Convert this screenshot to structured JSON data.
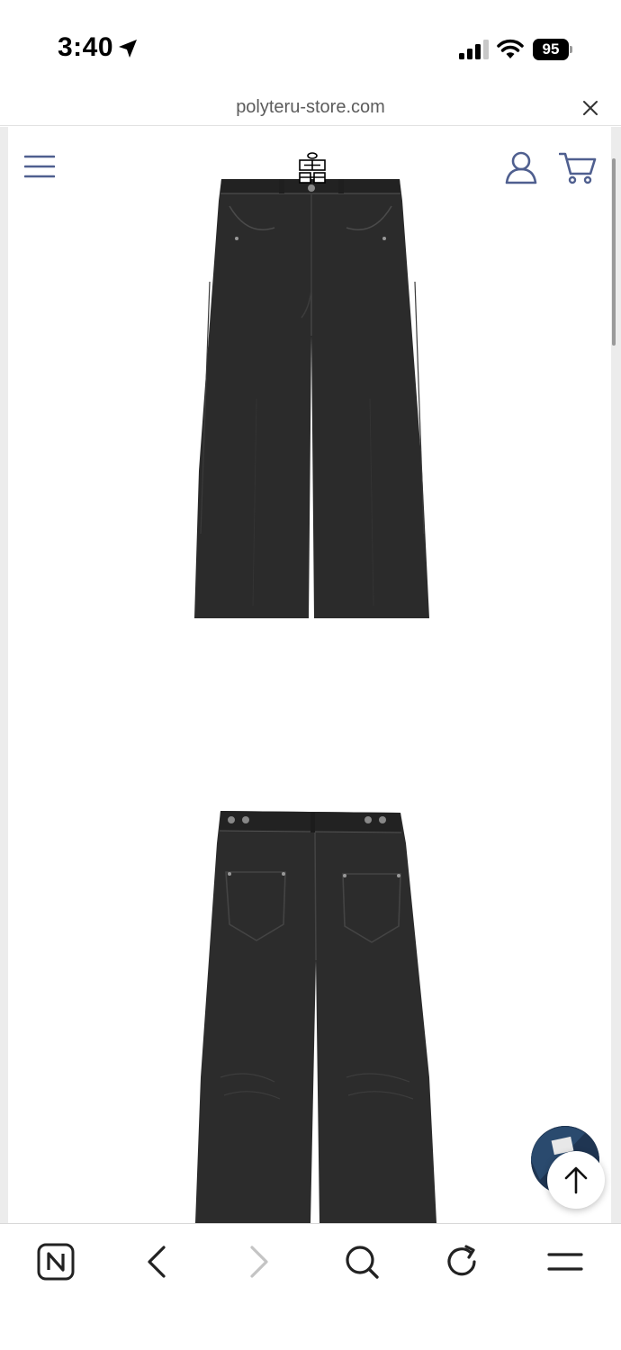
{
  "status_bar": {
    "time": "3:40",
    "battery": "95",
    "icons": [
      "location-arrow-icon",
      "signal-icon",
      "wifi-icon",
      "battery-icon"
    ]
  },
  "browser": {
    "url": "polyteru-store.com",
    "toolbar_icons": [
      "naver-icon",
      "back-icon",
      "forward-icon",
      "search-icon",
      "reload-icon",
      "menu-icon"
    ]
  },
  "site_header": {
    "icons": [
      "hamburger-menu-icon",
      "store-logo",
      "account-icon",
      "cart-icon"
    ]
  },
  "product_images": [
    "jeans-front",
    "jeans-back"
  ],
  "floating": [
    "chat-bubble",
    "scroll-to-top-icon"
  ],
  "colors": {
    "header_icon": "#4f5f8f",
    "jeans": "#2a2a2a"
  }
}
